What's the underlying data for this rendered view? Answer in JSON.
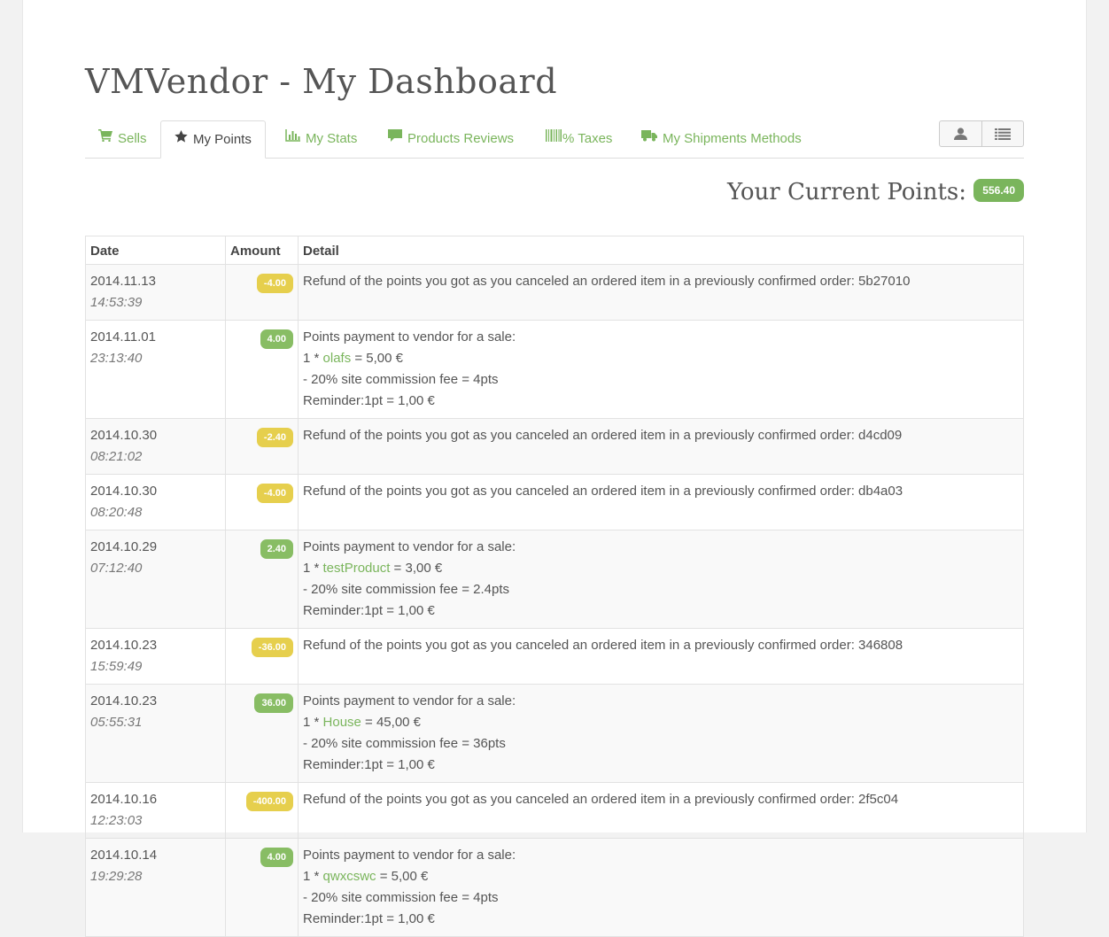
{
  "page_title": "VMVendor - My Dashboard",
  "tabs": [
    {
      "label": "Sells",
      "icon": "cart-icon"
    },
    {
      "label": "My Points",
      "icon": "star-icon"
    },
    {
      "label": "My Stats",
      "icon": "bar-chart-icon"
    },
    {
      "label": "Products Reviews",
      "icon": "comment-icon"
    },
    {
      "label": "% Taxes",
      "icon": "barcode-icon"
    },
    {
      "label": "My Shipments Methods",
      "icon": "truck-icon"
    }
  ],
  "toolbar": {
    "user_icon": "user-icon",
    "list_icon": "list-icon"
  },
  "points": {
    "label": "Your Current Points:",
    "value": "556.40"
  },
  "table": {
    "headers": {
      "date": "Date",
      "amount": "Amount",
      "detail": "Detail"
    },
    "rows": [
      {
        "date": "2014.11.13",
        "time": "14:53:39",
        "amount": "-4.00",
        "type": "refund",
        "detail": "Refund of the points you got as you canceled an ordered item in a previously confirmed order: 5b27010"
      },
      {
        "date": "2014.11.01",
        "time": "23:13:40",
        "amount": "4.00",
        "type": "sale",
        "line1": "Points payment to vendor for a sale:",
        "qty": "1 * ",
        "product": "olafs",
        "price": " = 5,00 €",
        "fee": "- 20% site commission fee = 4pts",
        "reminder": "Reminder:1pt = 1,00 €"
      },
      {
        "date": "2014.10.30",
        "time": "08:21:02",
        "amount": "-2.40",
        "type": "refund",
        "detail": "Refund of the points you got as you canceled an ordered item in a previously confirmed order: d4cd09"
      },
      {
        "date": "2014.10.30",
        "time": "08:20:48",
        "amount": "-4.00",
        "type": "refund",
        "detail": "Refund of the points you got as you canceled an ordered item in a previously confirmed order: db4a03"
      },
      {
        "date": "2014.10.29",
        "time": "07:12:40",
        "amount": "2.40",
        "type": "sale",
        "line1": "Points payment to vendor for a sale:",
        "qty": "1 * ",
        "product": "testProduct",
        "price": " = 3,00 €",
        "fee": "- 20% site commission fee = 2.4pts",
        "reminder": "Reminder:1pt = 1,00 €"
      },
      {
        "date": "2014.10.23",
        "time": "15:59:49",
        "amount": "-36.00",
        "type": "refund",
        "detail": "Refund of the points you got as you canceled an ordered item in a previously confirmed order: 346808"
      },
      {
        "date": "2014.10.23",
        "time": "05:55:31",
        "amount": "36.00",
        "type": "sale",
        "line1": "Points payment to vendor for a sale:",
        "qty": "1 * ",
        "product": "House",
        "price": " = 45,00 €",
        "fee": "- 20% site commission fee = 36pts",
        "reminder": "Reminder:1pt = 1,00 €"
      },
      {
        "date": "2014.10.16",
        "time": "12:23:03",
        "amount": "-400.00",
        "type": "refund",
        "detail": "Refund of the points you got as you canceled an ordered item in a previously confirmed order: 2f5c04"
      },
      {
        "date": "2014.10.14",
        "time": "19:29:28",
        "amount": "4.00",
        "type": "sale",
        "line1": "Points payment to vendor for a sale:",
        "qty": "1 * ",
        "product": "qwxcswc",
        "price": " = 5,00 €",
        "fee": "- 20% site commission fee = 4pts",
        "reminder": "Reminder:1pt = 1,00 €"
      }
    ]
  },
  "colors": {
    "accent": "#7ab55c",
    "positive": "#88bd64",
    "negative": "#e6cf4d"
  }
}
